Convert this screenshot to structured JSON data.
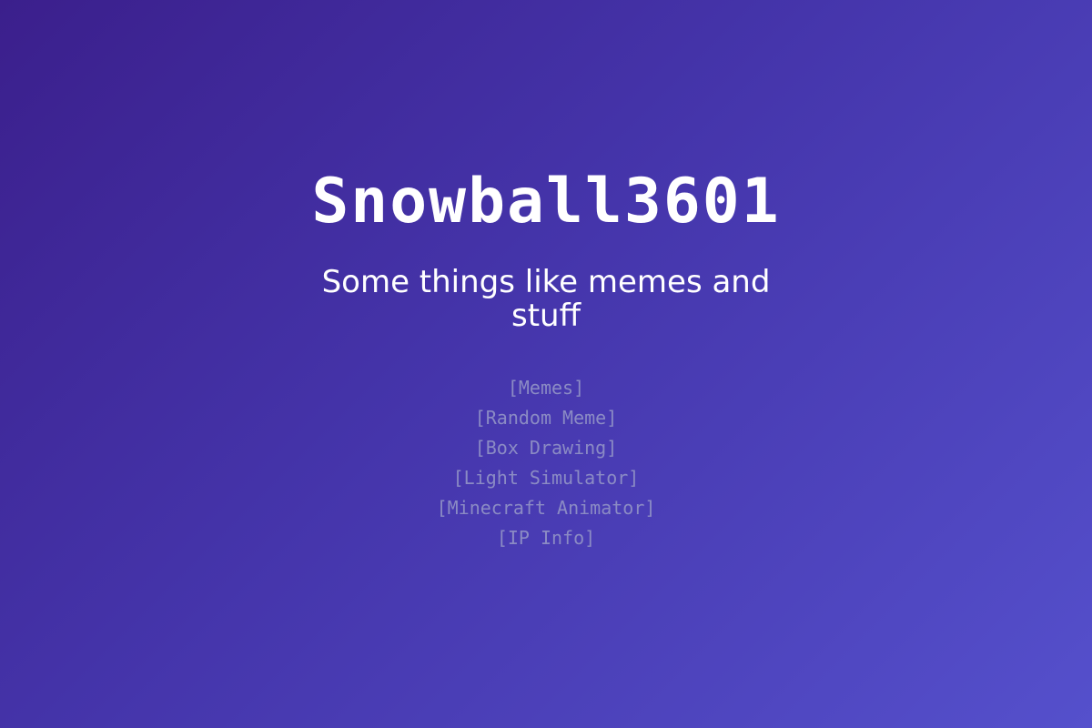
{
  "header": {
    "title": "Snowball3601",
    "tagline": "Some things like memes and stuff"
  },
  "nav": {
    "links": [
      {
        "label": "[Memes]"
      },
      {
        "label": "[Random Meme]"
      },
      {
        "label": "[Box Drawing]"
      },
      {
        "label": "[Light Simulator]"
      },
      {
        "label": "[Minecraft Animator]"
      },
      {
        "label": "[IP Info]"
      }
    ]
  },
  "colors": {
    "background_start": "#3b1f8c",
    "background_end": "#5550cc",
    "title_text": "#ffffff",
    "link_text": "#8b8bc4"
  }
}
